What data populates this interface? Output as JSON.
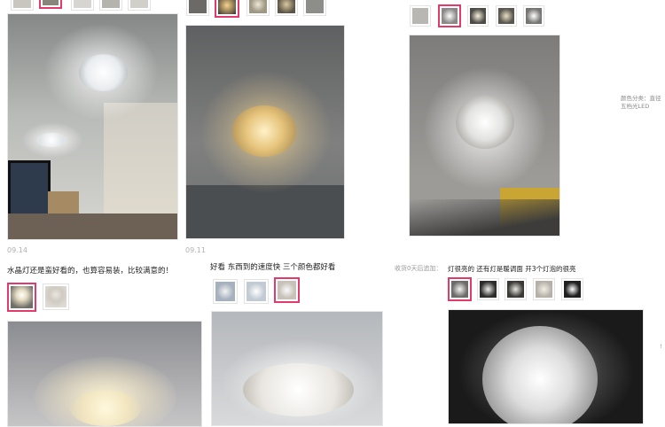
{
  "reviews": [
    {
      "date": "09.14",
      "comment": "水晶灯还是蛮好看的，也算容易装，比较满意的！",
      "thumbnails": [
        "thumb-1",
        "thumb-2",
        "thumb-3",
        "thumb-4",
        "thumb-5"
      ],
      "selected": 1
    },
    {
      "date": "09.11",
      "comment": "好看 东西到的速度快 三个颜色都好看",
      "thumbnails": [
        "thumb-1",
        "thumb-2",
        "thumb-3",
        "thumb-4",
        "thumb-5"
      ],
      "selected": 1
    },
    {
      "appended_label": "收货0天后追加：",
      "comment": "灯很亮的 还有灯是暖调面 开3个灯泡的很亮",
      "thumbnails": [
        "thumb-1",
        "thumb-2",
        "thumb-3",
        "thumb-4",
        "thumb-5"
      ],
      "selected": 1
    }
  ],
  "sku_info": {
    "line1": "颜色分类：直径",
    "line2": "五档光LED"
  },
  "colors": {
    "accent": "#e4396b"
  }
}
